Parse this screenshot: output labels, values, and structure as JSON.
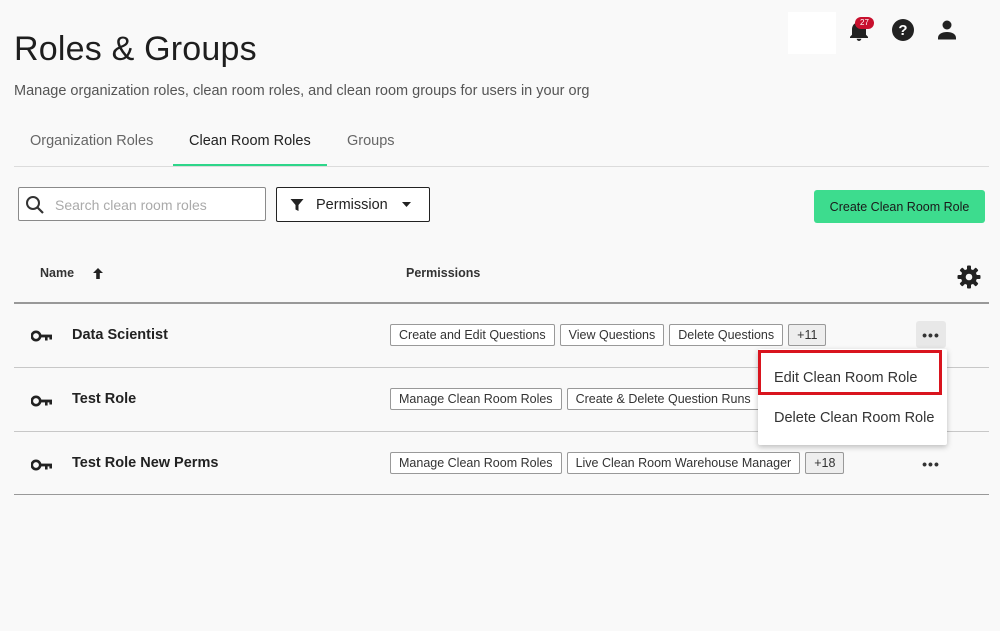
{
  "header": {
    "notification_count": "27",
    "title": "Roles & Groups",
    "subtitle": "Manage organization roles, clean room roles, and clean room groups for users in your org"
  },
  "tabs": [
    {
      "label": "Organization Roles",
      "active": false
    },
    {
      "label": "Clean Room Roles",
      "active": true
    },
    {
      "label": "Groups",
      "active": false
    }
  ],
  "toolbar": {
    "search_placeholder": "Search clean room roles",
    "filter_label": "Permission",
    "create_label": "Create Clean Room Role"
  },
  "table": {
    "columns": [
      "Name",
      "Permissions"
    ],
    "rows": [
      {
        "name": "Data Scientist",
        "permissions": [
          "Create and Edit Questions",
          "View Questions",
          "Delete Questions"
        ],
        "more": "+11"
      },
      {
        "name": "Test Role",
        "permissions": [
          "Manage Clean Room Roles",
          "Create & Delete Question Runs"
        ],
        "more": ""
      },
      {
        "name": "Test Role New Perms",
        "permissions": [
          "Manage Clean Room Roles",
          "Live Clean Room Warehouse Manager"
        ],
        "more": "+18"
      }
    ]
  },
  "row_menu": {
    "items": [
      "Edit Clean Room Role",
      "Delete Clean Room Role"
    ]
  },
  "colors": {
    "accent": "#3ddc8e",
    "highlight": "#d9141e",
    "badge": "#c8102e"
  }
}
